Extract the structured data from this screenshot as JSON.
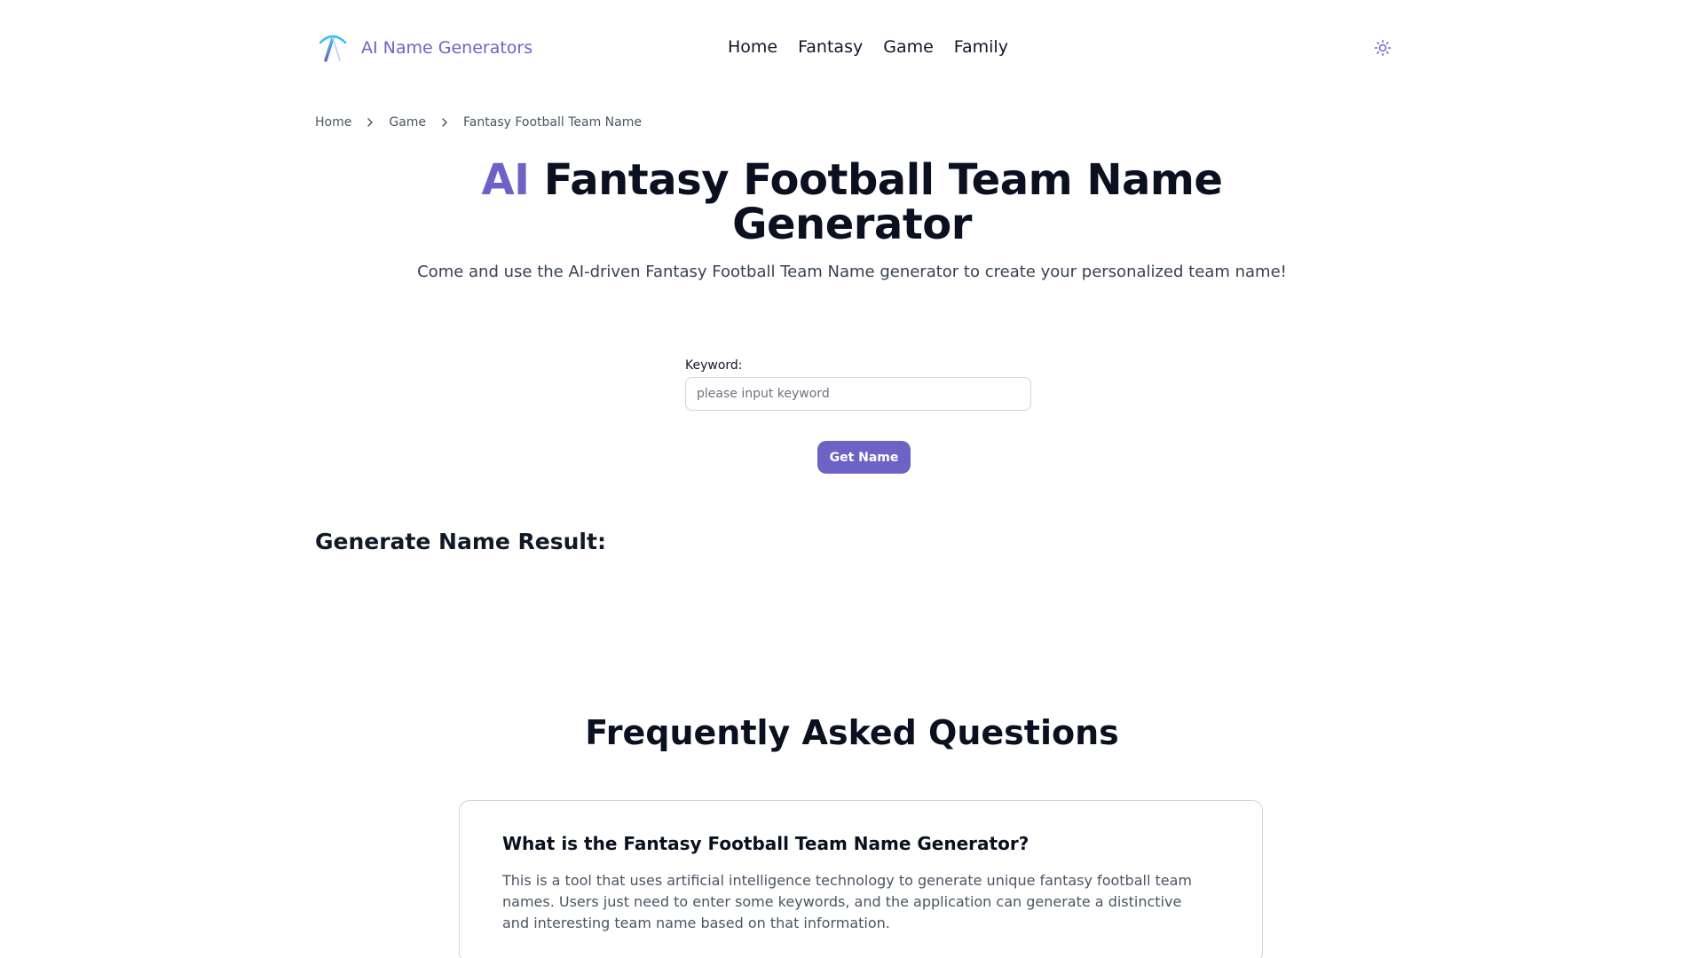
{
  "header": {
    "brand": "AI Name Generators",
    "nav": [
      "Home",
      "Fantasy",
      "Game",
      "Family"
    ],
    "theme_icon": "sun-icon"
  },
  "breadcrumb": [
    "Home",
    "Game",
    "Fantasy Football Team Name"
  ],
  "hero": {
    "title_accent": "AI",
    "title_rest": "Fantasy Football Team Name Generator",
    "subtitle": "Come and use the AI-driven Fantasy Football Team Name generator to create your personalized team name!"
  },
  "form": {
    "label": "Keyword:",
    "placeholder": "please input keyword",
    "value": "",
    "button": "Get Name"
  },
  "result": {
    "title": "Generate Name Result:"
  },
  "faq": {
    "title": "Frequently Asked Questions",
    "items": [
      {
        "q": "What is the Fantasy Football Team Name Generator?",
        "a": "This is a tool that uses artificial intelligence technology to generate unique fantasy football team names. Users just need to enter some keywords, and the application can generate a distinctive and interesting team name based on that information."
      }
    ]
  },
  "colors": {
    "accent": "#6d63c7",
    "heading": "#0b1020"
  }
}
